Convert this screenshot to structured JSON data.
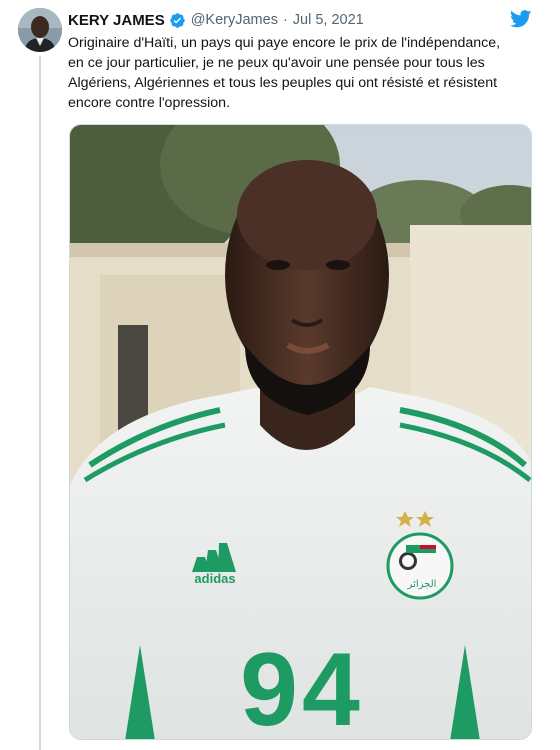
{
  "tweet": {
    "author_name": "KERY JAMES",
    "handle": "@KeryJames",
    "separator": "·",
    "date": "Jul 5, 2021",
    "text_lines": [
      "Originaire d'Haïti, un pays qui paye encore  le prix de l'indépendance,",
      "en ce jour particulier, je ne peux qu'avoir une pensée pour tous les",
      "Algériens, Algériennes et tous les peuples qui ont résisté et résistent",
      "encore contre l'opression."
    ],
    "verified_icon": "verified-badge-icon",
    "platform_icon": "twitter-bird-icon",
    "accent_color": "#1d9bf0"
  },
  "photo": {
    "jersey_brand": "adidas",
    "jersey_number": "94",
    "crest_text": "الجزائر",
    "jersey_accent_color": "#1e9a63"
  }
}
